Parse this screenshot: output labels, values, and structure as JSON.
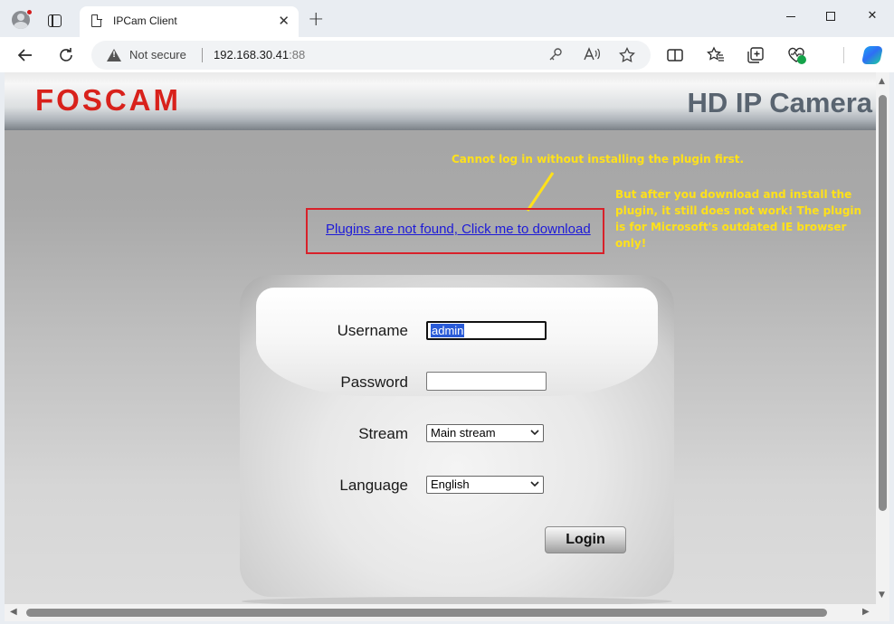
{
  "browser": {
    "tab_title": "IPCam Client",
    "close_glyph": "✕",
    "new_tab_glyph": "+",
    "security_label": "Not secure",
    "url_host": "192.168.30.41",
    "url_port": ":88"
  },
  "header": {
    "logo_text": "FOSCAM",
    "product_title": "HD IP Camera",
    "logo_color": "#d8211b",
    "title_color": "#596470"
  },
  "annotations": {
    "note1": "Cannot log in without installing the plugin first.",
    "note2": "But after you download and install the plugin, it still does not work! The plugin is for Microsoft's outdated IE browser only!",
    "note_color": "#ffe11a",
    "box_color": "#d8212a"
  },
  "plugin": {
    "link_text": "Plugins are not found, Click me to download"
  },
  "login": {
    "username_label": "Username",
    "username_value": "admin",
    "password_label": "Password",
    "password_value": "",
    "stream_label": "Stream",
    "stream_selected": "Main stream",
    "language_label": "Language",
    "language_selected": "English",
    "login_button": "Login"
  },
  "icons": {
    "back": "arrow-left-icon",
    "reload": "reload-icon",
    "warning": "warning-icon",
    "key": "key-icon",
    "read_aloud": "read-aloud-icon",
    "favorite": "star-icon",
    "split": "split-screen-icon",
    "favorites": "favorites-icon",
    "collections": "collections-icon",
    "health": "browser-essentials-icon",
    "copilot": "copilot-icon"
  }
}
